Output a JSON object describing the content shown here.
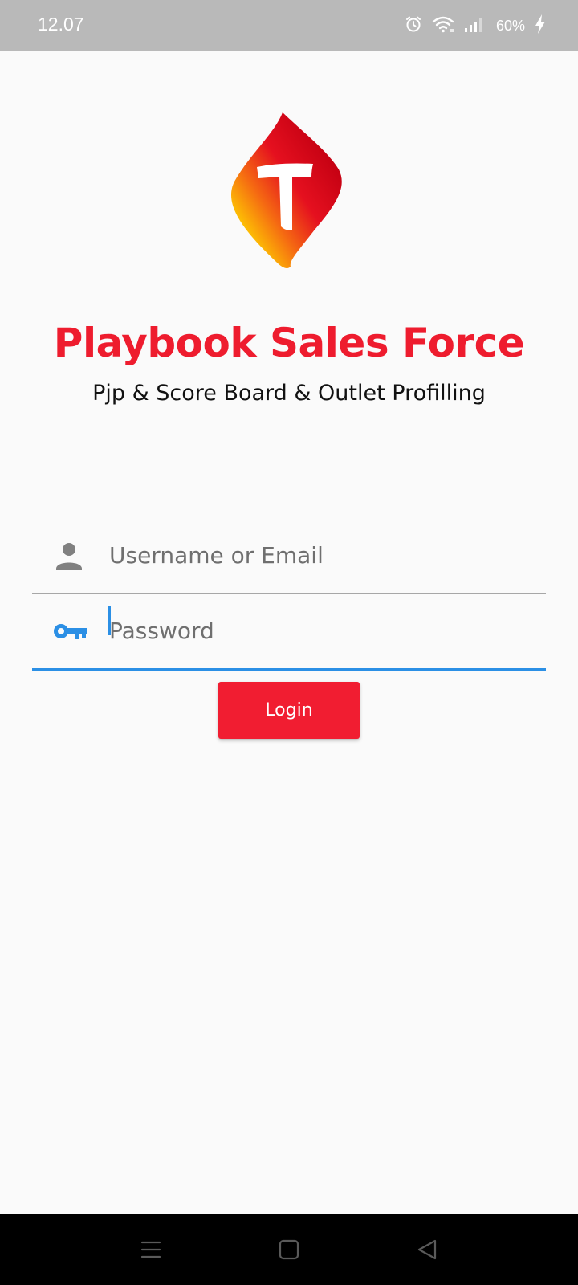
{
  "status_bar": {
    "time": "12.07",
    "battery": "60%",
    "icons": [
      "alarm-icon",
      "wifi-icon",
      "signal-icon",
      "charging-icon"
    ]
  },
  "logo": {
    "letter": "T",
    "colors": {
      "top": "#e0001a",
      "bottom": "#ffd200"
    }
  },
  "app": {
    "title": "Playbook Sales Force",
    "subtitle": "Pjp & Score Board & Outlet Profilling",
    "accent_color": "#ee1c2e"
  },
  "form": {
    "username_placeholder": "Username or Email",
    "username_value": "",
    "password_placeholder": "Password",
    "password_value": "",
    "login_label": "Login",
    "focus_color": "#2b8fe5"
  },
  "nav_bar": {
    "buttons": [
      "menu-icon",
      "home-icon",
      "back-icon"
    ]
  }
}
